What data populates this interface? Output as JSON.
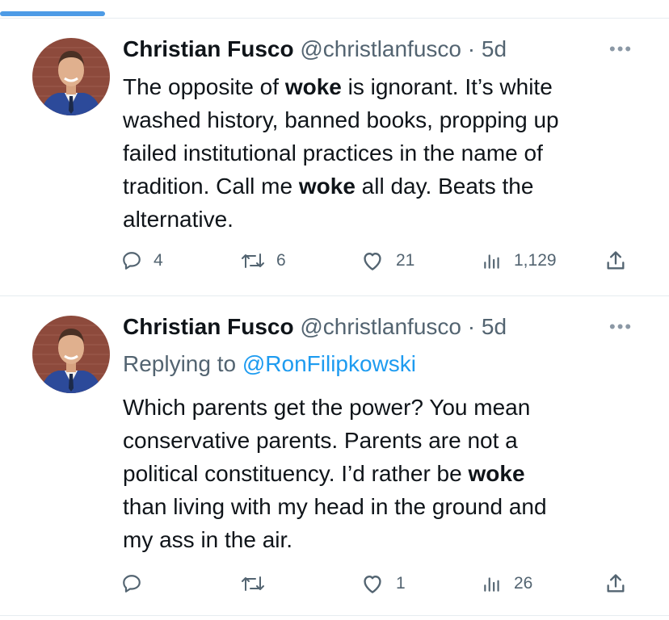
{
  "tweets": [
    {
      "author": "Christian Fusco",
      "handle": "@christlanfusco",
      "separator": "·",
      "time": "5d",
      "body": [
        {
          "t": "The opposite of ",
          "b": false
        },
        {
          "t": "woke",
          "b": true
        },
        {
          "t": " is ignorant.  It’s white\nwashed history, banned books, propping up\nfailed institutional practices in the name of\ntradition.  Call me ",
          "b": false
        },
        {
          "t": "woke",
          "b": true
        },
        {
          "t": " all day.  Beats the\nalternative.",
          "b": false
        }
      ],
      "actions": {
        "replies": "4",
        "retweets": "6",
        "likes": "21",
        "views": "1,129"
      }
    },
    {
      "author": "Christian Fusco",
      "handle": "@christlanfusco",
      "separator": "·",
      "time": "5d",
      "replying_to_label": "Replying to ",
      "replying_to_handle": "@RonFilipkowski",
      "body": [
        {
          "t": "Which parents get the power?  You mean\nconservative parents.  Parents are not a\npolitical constituency.  I’d rather be ",
          "b": false
        },
        {
          "t": "woke",
          "b": true
        },
        {
          "t": "\nthan living with my head in the ground and\nmy ass in the air.",
          "b": false
        }
      ],
      "actions": {
        "replies": "",
        "retweets": "",
        "likes": "1",
        "views": "26"
      }
    }
  ],
  "colors": {
    "accent": "#1d9bf0",
    "muted": "#536471",
    "tab_indicator": "#4d9be6"
  },
  "icons": [
    "reply-icon",
    "retweet-icon",
    "like-icon",
    "views-icon",
    "share-icon",
    "more-icon"
  ]
}
